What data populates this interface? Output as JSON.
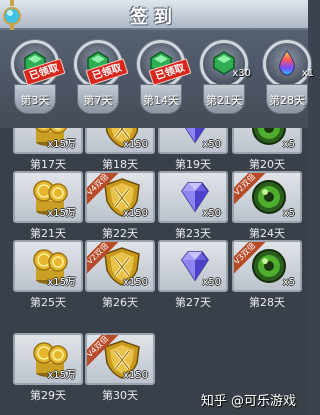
{
  "header": {
    "title": "签到"
  },
  "milestones": [
    {
      "label": "第3天",
      "claimed": true,
      "claimed_text": "已领取",
      "count": "",
      "item": "green-gem"
    },
    {
      "label": "第7天",
      "claimed": true,
      "claimed_text": "已领取",
      "count": "",
      "item": "green-gem"
    },
    {
      "label": "第14天",
      "claimed": true,
      "claimed_text": "已领取",
      "count": "",
      "item": "green-gem"
    },
    {
      "label": "第21天",
      "claimed": false,
      "claimed_text": "",
      "count": "x30",
      "item": "green-gem"
    },
    {
      "label": "第28天",
      "claimed": false,
      "claimed_text": "",
      "count": "x1",
      "item": "rainbow-drop"
    }
  ],
  "rows": [
    [
      {
        "day": "第17天",
        "qty": "x15万",
        "item": "gold-coins",
        "vip": ""
      },
      {
        "day": "第18天",
        "qty": "x150",
        "item": "shield",
        "vip": ""
      },
      {
        "day": "第19天",
        "qty": "x50",
        "item": "diamond",
        "vip": ""
      },
      {
        "day": "第20天",
        "qty": "x5",
        "item": "green-orb",
        "vip": ""
      }
    ],
    [
      {
        "day": "第21天",
        "qty": "x15万",
        "item": "gold-coins",
        "vip": ""
      },
      {
        "day": "第22天",
        "qty": "x150",
        "item": "shield",
        "vip": "V4双倍"
      },
      {
        "day": "第23天",
        "qty": "x50",
        "item": "diamond",
        "vip": ""
      },
      {
        "day": "第24天",
        "qty": "x5",
        "item": "green-orb",
        "vip": "V2双倍"
      }
    ],
    [
      {
        "day": "第25天",
        "qty": "x15万",
        "item": "gold-coins",
        "vip": ""
      },
      {
        "day": "第26天",
        "qty": "x150",
        "item": "shield",
        "vip": "V2双倍"
      },
      {
        "day": "第27天",
        "qty": "x50",
        "item": "diamond",
        "vip": ""
      },
      {
        "day": "第28天",
        "qty": "x5",
        "item": "green-orb",
        "vip": "V3双倍"
      }
    ],
    [
      {
        "day": "第29天",
        "qty": "x15万",
        "item": "gold-coins",
        "vip": ""
      },
      {
        "day": "第30天",
        "qty": "x150",
        "item": "shield",
        "vip": "V4双倍"
      }
    ]
  ],
  "watermark": "知乎 @可乐游戏"
}
